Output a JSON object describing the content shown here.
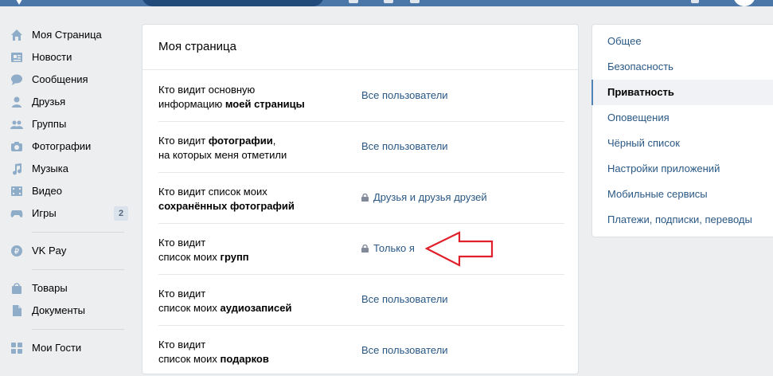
{
  "leftnav": {
    "items": [
      {
        "label": "Моя Страница",
        "icon": "home-icon"
      },
      {
        "label": "Новости",
        "icon": "news-icon"
      },
      {
        "label": "Сообщения",
        "icon": "messages-icon"
      },
      {
        "label": "Друзья",
        "icon": "friends-icon"
      },
      {
        "label": "Группы",
        "icon": "groups-icon"
      },
      {
        "label": "Фотографии",
        "icon": "camera-icon"
      },
      {
        "label": "Музыка",
        "icon": "music-icon"
      },
      {
        "label": "Видео",
        "icon": "video-icon"
      },
      {
        "label": "Игры",
        "icon": "gamepad-icon",
        "count": "2"
      },
      {
        "label": "VK Pay",
        "icon": "vkpay-icon"
      },
      {
        "label": "Товары",
        "icon": "bag-icon"
      },
      {
        "label": "Документы",
        "icon": "document-icon"
      },
      {
        "label": "Мои Гости",
        "icon": "apps-icon"
      }
    ]
  },
  "main": {
    "title": "Моя страница",
    "rows": [
      {
        "q1": "Кто видит основную",
        "q2a": "информацию ",
        "q2b": "моей страницы",
        "q1b": "",
        "value": "Все пользователи",
        "locked": false
      },
      {
        "q1": "Кто видит ",
        "q1b": "фотографии",
        "q1c": ",",
        "q2a": "на которых меня отметили",
        "q2b": "",
        "value": "Все пользователи",
        "locked": false
      },
      {
        "q1": "Кто видит список моих",
        "q1b": "",
        "q2a": "",
        "q2b": "сохранённых фотографий",
        "value": "Друзья и друзья друзей",
        "locked": true
      },
      {
        "q1": "Кто видит",
        "q1b": "",
        "q2a": "список моих ",
        "q2b": "групп",
        "value": "Только я",
        "locked": true
      },
      {
        "q1": "Кто видит",
        "q1b": "",
        "q2a": "список моих ",
        "q2b": "аудиозаписей",
        "value": "Все пользователи",
        "locked": false
      },
      {
        "q1": "Кто видит",
        "q1b": "",
        "q2a": "список моих ",
        "q2b": "подарков",
        "value": "Все пользователи",
        "locked": false
      }
    ]
  },
  "rightnav": {
    "items": [
      {
        "label": "Общее"
      },
      {
        "label": "Безопасность"
      },
      {
        "label": "Приватность",
        "active": true
      },
      {
        "label": "Оповещения"
      },
      {
        "label": "Чёрный список"
      },
      {
        "label": "Настройки приложений"
      },
      {
        "label": "Мобильные сервисы"
      },
      {
        "label": "Платежи, подписки, переводы"
      }
    ]
  },
  "colors": {
    "header": "#4a76a8",
    "link": "#2a5885",
    "nav_icon": "#8fadc8",
    "annotation_arrow": "#e0202a"
  }
}
